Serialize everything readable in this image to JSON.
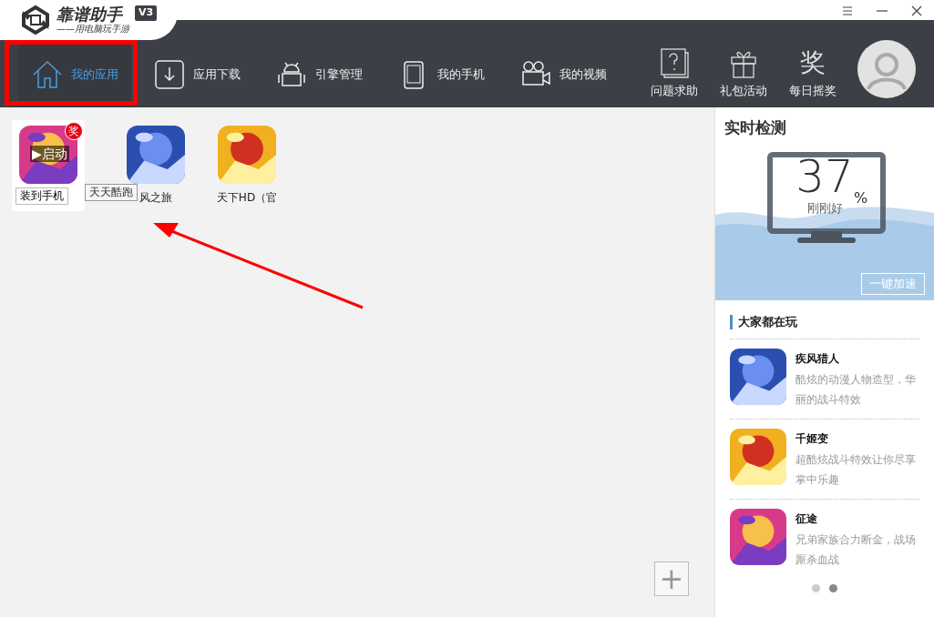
{
  "app": {
    "title": "靠谱助手",
    "version": "V3",
    "slogan": "——用电脑玩手游"
  },
  "window_controls": [
    {
      "kind": "menu"
    },
    {
      "kind": "minimize"
    },
    {
      "kind": "close"
    }
  ],
  "nav": [
    {
      "kind": "home",
      "label": "我的应用",
      "selected": true
    },
    {
      "kind": "download",
      "label": "应用下载",
      "selected": false
    },
    {
      "kind": "android",
      "label": "引擎管理",
      "selected": false
    },
    {
      "kind": "phone",
      "label": "我的手机",
      "selected": false
    },
    {
      "kind": "video",
      "label": "我的视频",
      "selected": false
    }
  ],
  "tools": [
    {
      "kind": "help",
      "label": "问题求助"
    },
    {
      "kind": "gift",
      "label": "礼包活动"
    },
    {
      "kind": "lottery",
      "glyph": "奖",
      "label": "每日摇奖"
    }
  ],
  "apps": [
    {
      "hovered": true,
      "badge": "奖",
      "launch": "▶启动",
      "install": "装到手机",
      "tooltip": "天天酷跑"
    },
    {
      "hovered": false,
      "name": "风之旅"
    },
    {
      "hovered": false,
      "name": "天下HD（官"
    }
  ],
  "add_button": "+",
  "monitor": {
    "title": "实时检测",
    "value": "37",
    "unit": "%",
    "status": "刚刚好",
    "button": "一键加速"
  },
  "popular": {
    "title": "大家都在玩",
    "games": [
      {
        "name": "疾风猎人",
        "description": "酷炫的动漫人物造型，华丽的战斗特效"
      },
      {
        "name": "千姬变",
        "description": "超酷炫战斗特效让你尽享掌中乐趣"
      },
      {
        "name": "征途",
        "description": "兄弟家族合力断金，战场厮杀血战"
      }
    ]
  },
  "carousel": [
    {
      "selected": false
    },
    {
      "selected": true
    }
  ],
  "annotation": {
    "frame": true,
    "arrow": true
  }
}
